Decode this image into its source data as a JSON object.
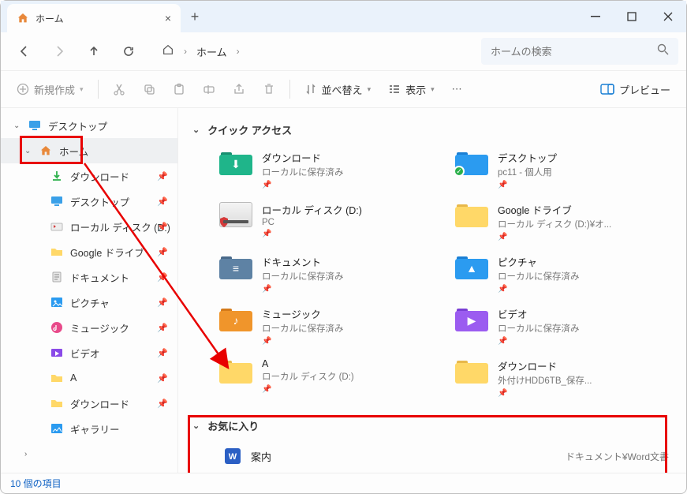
{
  "tab": {
    "title": "ホーム"
  },
  "breadcrumb": {
    "root": "ホーム"
  },
  "search": {
    "placeholder": "ホームの検索"
  },
  "toolbar": {
    "new": "新規作成",
    "sort": "並べ替え",
    "view": "表示",
    "preview": "プレビュー"
  },
  "sidebar": {
    "items": [
      {
        "label": "デスクトップ",
        "kind": "desktop",
        "depth": 0,
        "chev": "v"
      },
      {
        "label": "ホーム",
        "kind": "home",
        "depth": 1,
        "chev": "v",
        "selected": true,
        "highlight": true
      },
      {
        "label": "ダウンロード",
        "kind": "download",
        "depth": 2,
        "pin": true
      },
      {
        "label": "デスクトップ",
        "kind": "desktop",
        "depth": 2,
        "pin": true
      },
      {
        "label": "ローカル ディスク (D:)",
        "kind": "disk-shield",
        "depth": 2,
        "pin": true
      },
      {
        "label": "Google ドライブ",
        "kind": "folder",
        "depth": 2,
        "pin": true
      },
      {
        "label": "ドキュメント",
        "kind": "doc",
        "depth": 2,
        "pin": true
      },
      {
        "label": "ピクチャ",
        "kind": "picture",
        "depth": 2,
        "pin": true
      },
      {
        "label": "ミュージック",
        "kind": "music",
        "depth": 2,
        "pin": true
      },
      {
        "label": "ビデオ",
        "kind": "video",
        "depth": 2,
        "pin": true
      },
      {
        "label": "A",
        "kind": "folder",
        "depth": 2,
        "pin": true
      },
      {
        "label": "ダウンロード",
        "kind": "folder",
        "depth": 2,
        "pin": true
      },
      {
        "label": "ギャラリー",
        "kind": "gallery",
        "depth": 2
      },
      {
        "label": "",
        "kind": "blank",
        "depth": 1,
        "chev": ">"
      }
    ]
  },
  "sections": {
    "quick": "クイック アクセス",
    "fav": "お気に入り"
  },
  "quick": [
    {
      "name": "ダウンロード",
      "sub": "ローカルに保存済み",
      "icon": "download",
      "color": "teal",
      "pin": true
    },
    {
      "name": "デスクトップ",
      "sub": "pc11 - 個人用",
      "icon": "desktop",
      "color": "blue",
      "pin": true,
      "check": true
    },
    {
      "name": "ローカル ディスク (D:)",
      "sub": "PC",
      "icon": "disk",
      "pin": true
    },
    {
      "name": "Google ドライブ",
      "sub": "ローカル ディスク (D:)¥オ...",
      "icon": "folder",
      "color": "yellow",
      "pin": true
    },
    {
      "name": "ドキュメント",
      "sub": "ローカルに保存済み",
      "icon": "doc",
      "color": "slate",
      "pin": true
    },
    {
      "name": "ピクチャ",
      "sub": "ローカルに保存済み",
      "icon": "picture",
      "color": "blue",
      "pin": true
    },
    {
      "name": "ミュージック",
      "sub": "ローカルに保存済み",
      "icon": "music",
      "color": "orange",
      "pin": true
    },
    {
      "name": "ビデオ",
      "sub": "ローカルに保存済み",
      "icon": "video",
      "color": "purple",
      "pin": true
    },
    {
      "name": "A",
      "sub": "ローカル ディスク (D:)",
      "icon": "folder",
      "color": "yellow",
      "pin": true
    },
    {
      "name": "ダウンロード",
      "sub": "外付けHDD6TB_保存...",
      "icon": "folder",
      "color": "yellow",
      "pin": true
    }
  ],
  "favorites": [
    {
      "name": "案内",
      "loc": "ドキュメント¥Word文書",
      "icon": "word"
    }
  ],
  "status": "10 個の項目"
}
